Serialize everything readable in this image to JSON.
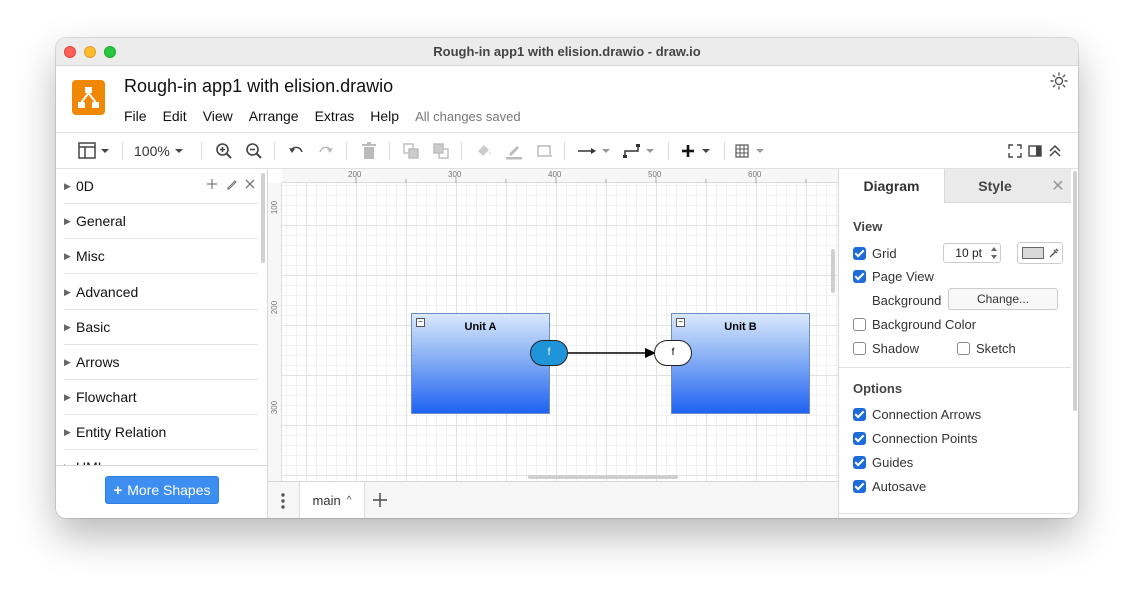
{
  "window": {
    "title": "Rough-in app1 with elision.drawio - draw.io"
  },
  "header": {
    "doc_title": "Rough-in app1 with elision.drawio",
    "menu": [
      "File",
      "Edit",
      "View",
      "Arrange",
      "Extras",
      "Help"
    ],
    "status": "All changes saved"
  },
  "toolbar": {
    "zoom": "100%"
  },
  "sidebar": {
    "categories": [
      "0D",
      "General",
      "Misc",
      "Advanced",
      "Basic",
      "Arrows",
      "Flowchart",
      "Entity Relation",
      "UML"
    ],
    "more_shapes": "More Shapes"
  },
  "canvas": {
    "ruler_top": [
      "200",
      "300",
      "400",
      "500",
      "600"
    ],
    "ruler_left": [
      "100",
      "200",
      "300"
    ],
    "unit_a": {
      "label": "Unit A",
      "port": "f"
    },
    "unit_b": {
      "label": "Unit B",
      "port": "f"
    },
    "connector_color": "#000000",
    "unit_gradient": [
      "#dae8fc",
      "#1f63f3"
    ]
  },
  "pages": {
    "tabs": [
      "main"
    ]
  },
  "format_panel": {
    "tabs": [
      "Diagram",
      "Style"
    ],
    "view_heading": "View",
    "grid": {
      "label": "Grid",
      "checked": true,
      "size": "10 pt"
    },
    "page_view": {
      "label": "Page View",
      "checked": true
    },
    "background": {
      "label": "Background",
      "button": "Change..."
    },
    "background_color": {
      "label": "Background Color",
      "checked": false
    },
    "shadow": {
      "label": "Shadow",
      "checked": false
    },
    "sketch": {
      "label": "Sketch",
      "checked": false
    },
    "options_heading": "Options",
    "options": [
      {
        "label": "Connection Arrows",
        "checked": true
      },
      {
        "label": "Connection Points",
        "checked": true
      },
      {
        "label": "Guides",
        "checked": true
      },
      {
        "label": "Autosave",
        "checked": true
      }
    ]
  }
}
